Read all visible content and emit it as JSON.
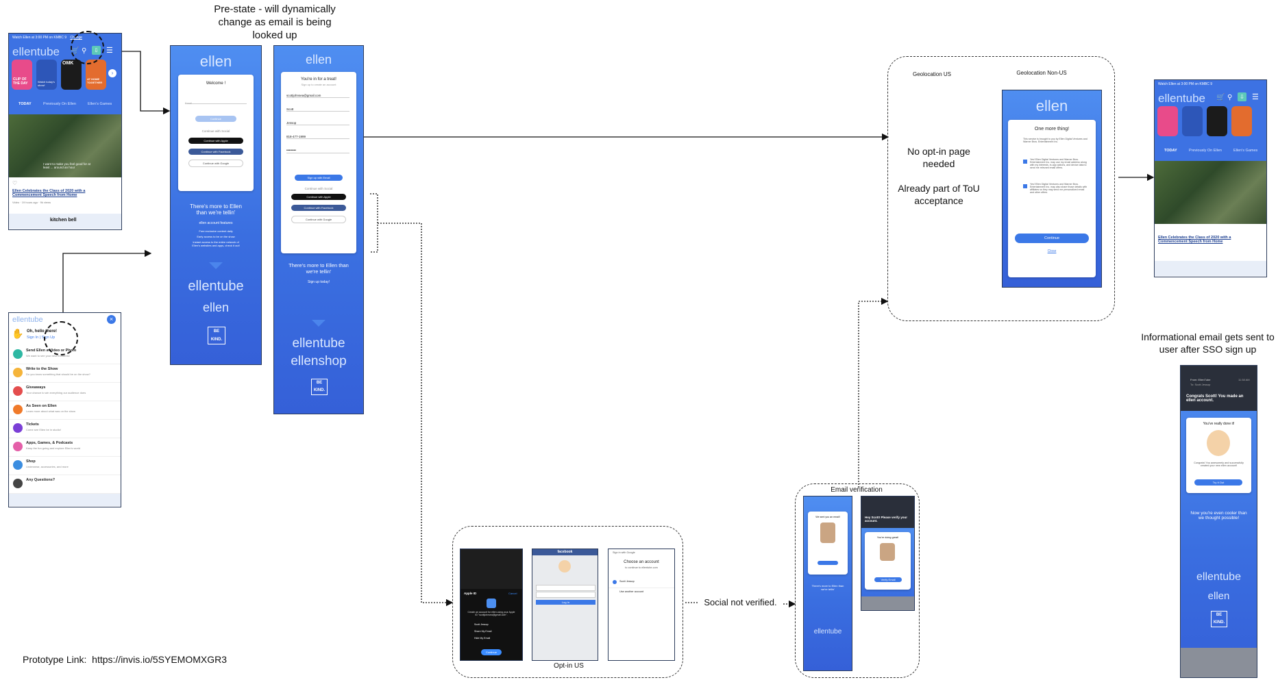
{
  "annotations": {
    "prestate": "Pre-state - will dynamically change as email is being looked up",
    "geo_us": "Geolocation US",
    "geo_non_us": "Geolocation Non-US",
    "no_optin_1": "No opt-in page needed",
    "no_optin_2": "Already part of ToU acceptance",
    "informational": "Informational email gets sent to user after SSO sign up",
    "email_verification": "Email verification",
    "optin_us": "Opt-in US",
    "social_not_verified": "Social not verified.",
    "prototype_label": "Prototype Link:",
    "prototype_url": "https://invis.io/5SYEMOMXGR3"
  },
  "app_screen": {
    "banner": "Watch Ellen at 3:00 PM on KMBC 9",
    "banner_link": "Change",
    "logo": "ellentube",
    "tabs": [
      "TODAY",
      "Previously On Ellen",
      "Ellen's Games"
    ],
    "thumb_labels": [
      "CLIP OF THE DAY",
      "Watch today's show!",
      "OMK",
      "AT HOME TOGETHER"
    ],
    "video_caption": "I want to make you feel good for at least ... around an hour",
    "video_title": "Ellen Celebrates the Class of 2020 with a Commencement Speech from Home",
    "video_meta": "Video · 19 hours ago · 9k views",
    "ad_text": "kitchen bell"
  },
  "menu_screen": {
    "logo": "ellentube",
    "greeting": "Oh, hello there!",
    "sign_in": "Sign In",
    "sign_up": "Sign Up",
    "items": [
      {
        "title": "Send Ellen a Video or Photo",
        "sub": "We want to see your best moments!",
        "color": "#2eb8a3"
      },
      {
        "title": "Write to the Show",
        "sub": "Do you know something that should be on the show?",
        "color": "#f5b43a"
      },
      {
        "title": "Giveaways",
        "sub": "Your chance to win everything our audience does",
        "color": "#e44d4d"
      },
      {
        "title": "As Seen on Ellen",
        "sub": "Learn more about what was on the show",
        "color": "#f07a2a"
      },
      {
        "title": "Tickets",
        "sub": "Come see Ellen be in studio!",
        "color": "#7b3fd6"
      },
      {
        "title": "Apps, Games, & Podcasts",
        "sub": "Keep the fun going and explore Ellen's world",
        "color": "#e45fa8"
      },
      {
        "title": "Shop",
        "sub": "Underwear, accessories, and more",
        "color": "#3b8de0"
      },
      {
        "title": "Any Questions?",
        "sub": "",
        "color": "#444444"
      }
    ]
  },
  "welcome_screen": {
    "logo": "ellen",
    "title": "Welcome !",
    "email_placeholder": "Email",
    "continue_label": "Continue",
    "social_label": "Continue with Social",
    "apple": "Continue with Apple",
    "facebook": "Continue with Facebook",
    "google": "Continue with Google",
    "promo_title": "There's more to Ellen than we're tellin'",
    "promo_sub": "ellen account features",
    "promo_lines": [
      "Free exclusive content daily",
      "Early access to be on the show",
      "Instant access to the entire network of Ellen's websites and apps, check it out!"
    ],
    "footer_logo_1": "ellentube",
    "footer_logo_2": "ellen",
    "be_kind": "BE KIND."
  },
  "signup_screen": {
    "logo": "ellen",
    "title": "You're in for a treat!",
    "subtitle": "Sign up to create an account",
    "email_value": "scottjohnsea@gmail.com",
    "first_name": "Scott",
    "last_name": "Jessop",
    "phone": "818-477-1999",
    "password": "••••••••",
    "signup_label": "Sign up with Email",
    "social_label": "Continue with Social",
    "apple": "Continue with Apple",
    "facebook": "Continue with Facebook",
    "google": "Continue with Google",
    "promo_title": "There's more to Ellen than we're tellin'",
    "promo_sub": "Sign up today!",
    "footer_logo_1": "ellentube",
    "footer_logo_2": "ellenshop",
    "be_kind": "BE KIND."
  },
  "optin_screen": {
    "logo": "ellen",
    "title": "One more thing!",
    "body": "This service is brought to you by Ellen Digital Ventures and Warner Bros. Entertainment Inc.",
    "check1": "Yes! Ellen Digital Ventures and Warner Bros. Entertainment Inc. may use my email address along with my interests, in-app actions, and device data to send me relevant email offers.",
    "check2": "Yes! Ellen Digital Ventures and Warner Bros. Entertainment Inc. may also share those details with affiliates so they may send me personalized email and other offers.",
    "continue_label": "Continue",
    "close_label": "Close"
  },
  "final_email": {
    "from": "From: EllenTube",
    "to": "To: Scott Jessop",
    "time": "11:38 AM",
    "headline": "Congrats Scott! You made an ellen account.",
    "card_title": "You've really done it!",
    "card_body": "Congrats! You awesomely and successfully created your new ellen account!",
    "card_btn": "Try It Out",
    "cool_text": "Now you're even cooler than we thought possible!",
    "logo1": "ellentube",
    "logo2": "ellen",
    "be_kind": "BE KIND."
  },
  "verify_screens": {
    "left_title": "We sent you an email!",
    "left_promo": "There's more to Ellen than we're tellin'",
    "right_headline": "Hey Scott! Please verify your account.",
    "right_card": "You're doing great!",
    "right_btn": "Verify Email"
  },
  "social_screens": {
    "apple_title": "Apple ID",
    "apple_cancel": "Cancel",
    "apple_body": "Create an account for ellen using your Apple ID \"scottjohnsea@gmail.com\".",
    "apple_name": "Scott Jessop",
    "apple_share": "Share My Email",
    "apple_hide": "Hide My Email",
    "apple_continue": "Continue",
    "fb_header": "facebook",
    "fb_login": "Log In",
    "google_header": "Sign in with Google",
    "google_title": "Choose an account",
    "google_sub": "to continue to ellentube.com",
    "google_account": "Scott Jessop",
    "google_use_other": "Use another account"
  }
}
